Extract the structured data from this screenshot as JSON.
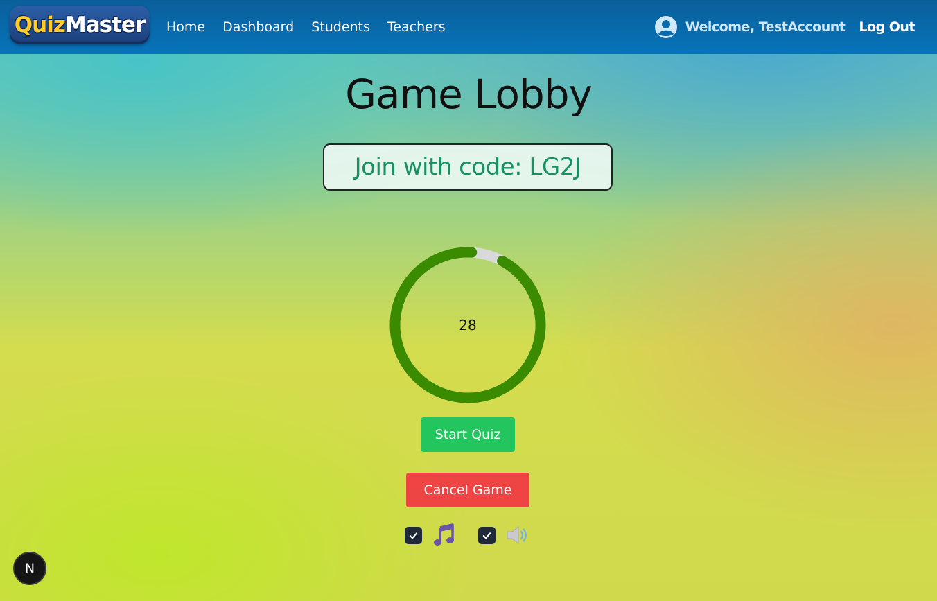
{
  "navbar": {
    "logo_prefix": "Quiz",
    "logo_suffix": "Master",
    "links": [
      "Home",
      "Dashboard",
      "Students",
      "Teachers"
    ],
    "welcome": "Welcome, TestAccount",
    "logout": "Log Out",
    "user_icon": "user-circle-icon"
  },
  "main": {
    "title": "Game Lobby",
    "join_code_text": "Join with code: LG2J",
    "timer": {
      "value": "28",
      "progress_fraction": 0.93,
      "progress_color": "#3a8b00",
      "track_color": "#d9d9d9"
    },
    "start_button": "Start Quiz",
    "cancel_button": "Cancel Game",
    "toggles": {
      "music": {
        "checked": true,
        "icon": "music-note-icon"
      },
      "sound": {
        "checked": true,
        "icon": "speaker-icon"
      }
    }
  },
  "dev_badge": "N",
  "colors": {
    "nav_bg": "#0774ba",
    "start_button": "#22c55e",
    "cancel_button": "#ef4444",
    "code_text": "#179062"
  }
}
